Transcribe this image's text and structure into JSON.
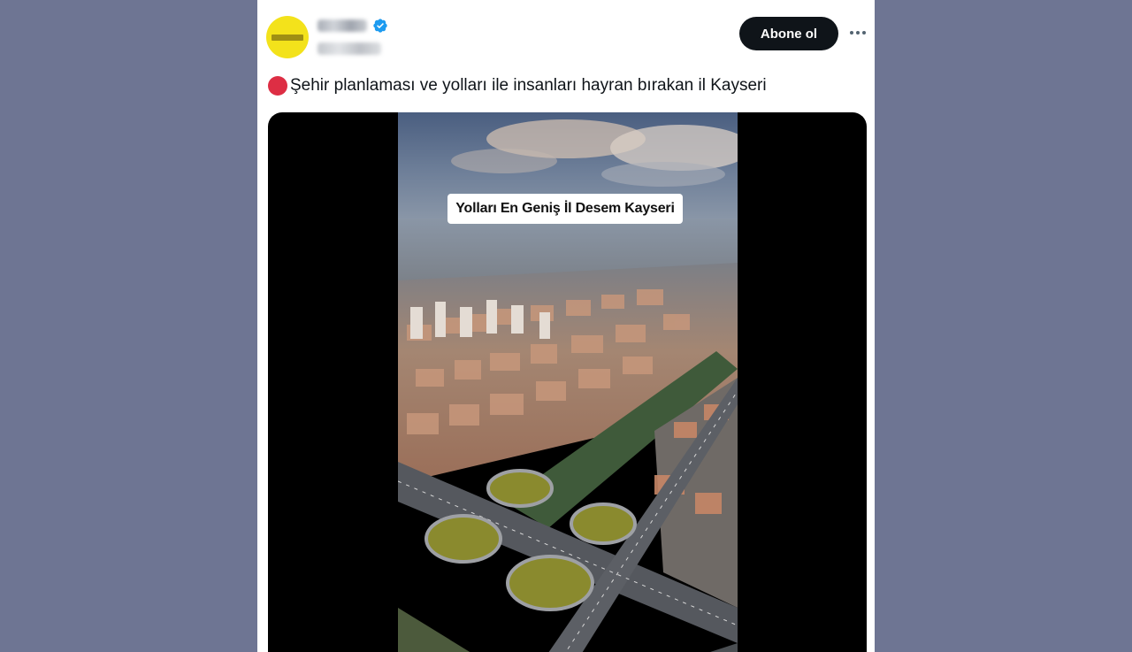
{
  "account": {
    "avatar_icon": "brand-logo-icon",
    "verified_icon": "verified-badge-icon",
    "verified_color": "#1d9bf0"
  },
  "actions": {
    "subscribe_label": "Abone ol",
    "more_icon": "more-options-icon"
  },
  "tweet": {
    "emoji_icon": "red-circle-icon",
    "emoji_color": "#dd2e44",
    "text": "Şehir planlaması ve yolları ile insanları hayran bırakan il Kayseri"
  },
  "media": {
    "type": "video",
    "overlay_caption": "Yolları En Geniş İl Desem Kayseri"
  },
  "colors": {
    "page_background": "#6e7593",
    "card_background": "#ffffff",
    "button_background": "#0f1419"
  }
}
